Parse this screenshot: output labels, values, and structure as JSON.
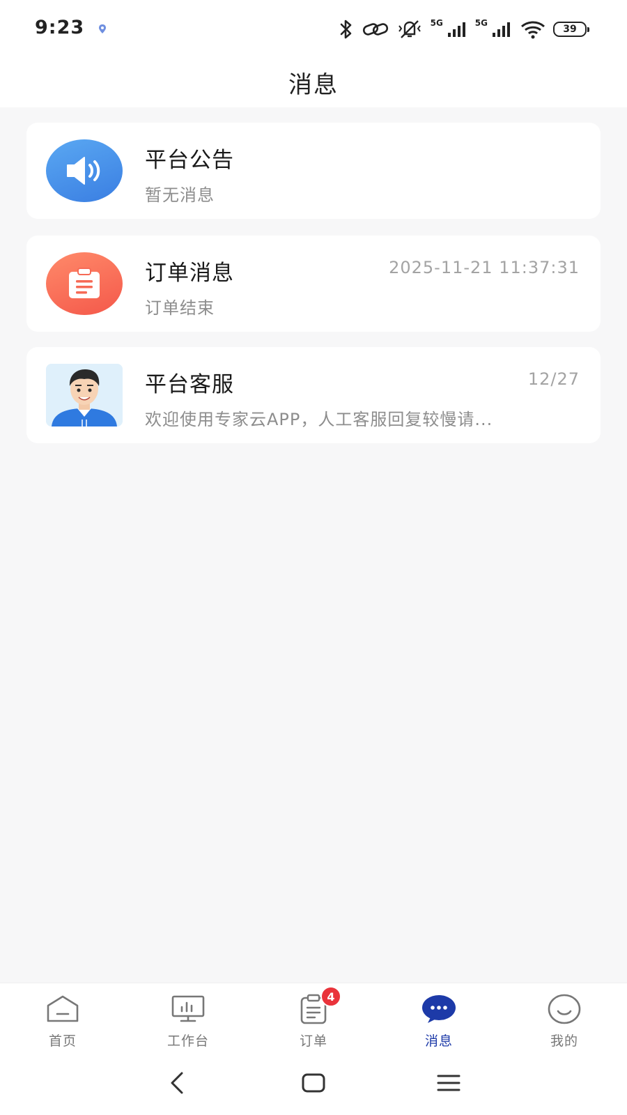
{
  "status_bar": {
    "time": "9:23",
    "network_label_1": "5G",
    "network_label_2": "5G",
    "battery": "39"
  },
  "header": {
    "title": "消息"
  },
  "messages": [
    {
      "title": "平台公告",
      "subtitle": "暂无消息",
      "time": "",
      "icon": "speaker-icon",
      "accent": "#4a93ec"
    },
    {
      "title": "订单消息",
      "subtitle": "订单结束",
      "time": "2025-11-21 11:37:31",
      "icon": "clipboard-icon",
      "accent": "#f66a56"
    },
    {
      "title": "平台客服",
      "subtitle": "欢迎使用专家云APP，人工客服回复较慢请...",
      "time": "12/27",
      "icon": "support-agent-avatar",
      "accent": "#2f7ae0"
    }
  ],
  "tabs": [
    {
      "label": "首页",
      "icon": "home-icon",
      "active": false
    },
    {
      "label": "工作台",
      "icon": "workbench-icon",
      "active": false
    },
    {
      "label": "订单",
      "icon": "order-icon",
      "active": false,
      "badge": "4"
    },
    {
      "label": "消息",
      "icon": "chat-icon",
      "active": true
    },
    {
      "label": "我的",
      "icon": "profile-icon",
      "active": false
    }
  ],
  "colors": {
    "active_tab": "#1d3aa8",
    "badge": "#e9333b",
    "background": "#f7f7f8"
  }
}
